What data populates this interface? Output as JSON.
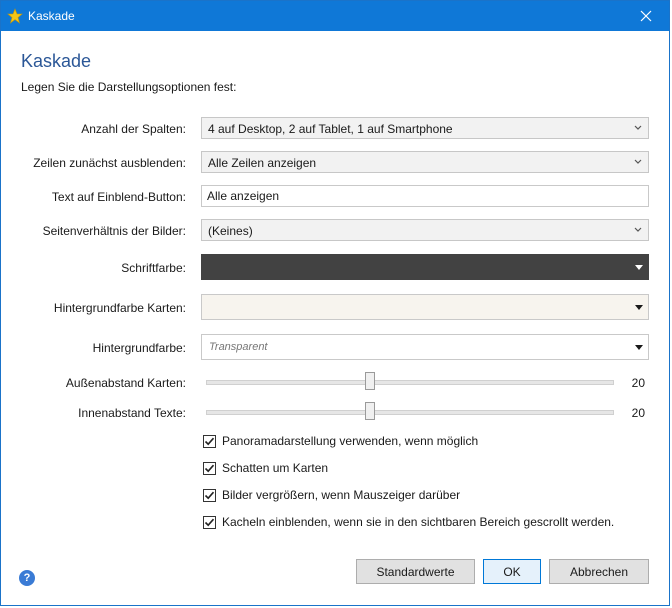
{
  "window": {
    "title": "Kaskade",
    "heading": "Kaskade",
    "subheading": "Legen Sie die Darstellungsoptionen fest:"
  },
  "form": {
    "columns": {
      "label": "Anzahl der Spalten:",
      "value": "4 auf Desktop, 2 auf Tablet, 1 auf Smartphone"
    },
    "hide_rows": {
      "label": "Zeilen zunächst ausblenden:",
      "value": "Alle Zeilen anzeigen"
    },
    "button_text": {
      "label": "Text auf Einblend-Button:",
      "value": "Alle anzeigen"
    },
    "aspect_ratio": {
      "label": "Seitenverhältnis der Bilder:",
      "value": "(Keines)"
    },
    "font_color": {
      "label": "Schriftfarbe:",
      "color": "#424242"
    },
    "card_bg_color": {
      "label": "Hintergrundfarbe Karten:",
      "color": "#f7f4ee"
    },
    "bg_color": {
      "label": "Hintergrundfarbe:",
      "placeholder": "Transparent"
    },
    "card_spacing": {
      "label": "Außenabstand Karten:",
      "value": "20",
      "level": 0.4
    },
    "text_padding": {
      "label": "Innenabstand Texte:",
      "value": "20",
      "level": 0.4
    }
  },
  "checkboxes": [
    {
      "label": "Panoramadarstellung verwenden, wenn möglich",
      "checked": true
    },
    {
      "label": "Schatten um Karten",
      "checked": true
    },
    {
      "label": "Bilder vergrößern, wenn Mauszeiger darüber",
      "checked": true
    },
    {
      "label": "Kacheln einblenden, wenn sie in den sichtbaren Bereich gescrollt werden.",
      "checked": true
    }
  ],
  "buttons": {
    "defaults": "Standardwerte",
    "ok": "OK",
    "cancel": "Abbrechen"
  },
  "icons": {
    "app": "star-icon",
    "close": "close-icon",
    "help": "help-icon"
  },
  "colors": {
    "titlebar": "#0f78d7",
    "heading": "#2b5797",
    "accent": "#0078d7"
  }
}
